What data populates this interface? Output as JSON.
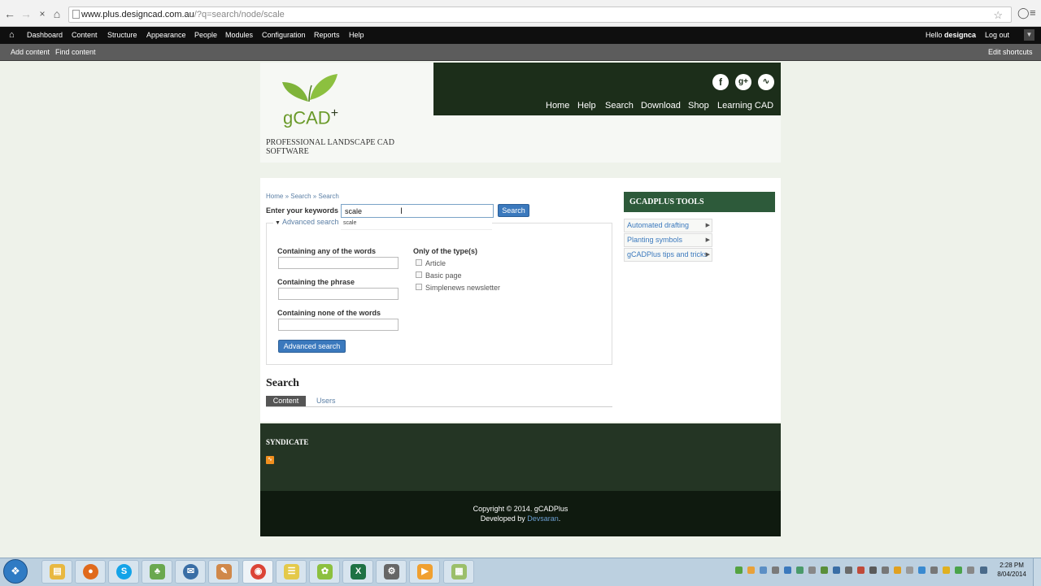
{
  "browser": {
    "url_main": "www.plus.designcad.com.au",
    "url_rest": "/?q=search/node/scale"
  },
  "toolbar": {
    "items": [
      "Dashboard",
      "Content",
      "Structure",
      "Appearance",
      "People",
      "Modules",
      "Configuration",
      "Reports",
      "Help"
    ],
    "hello_prefix": "Hello ",
    "username": "designca",
    "logout": "Log out"
  },
  "shortcuts": {
    "add_content": "Add content",
    "find_content": "Find content",
    "edit_shortcuts": "Edit shortcuts"
  },
  "header": {
    "logo_text": "gCAD",
    "logo_plus": "+",
    "slogan": "PROFESSIONAL LANDSCAPE CAD SOFTWARE",
    "social": [
      "facebook-icon",
      "google-plus-icon",
      "rss-icon"
    ],
    "menu": [
      "Home",
      "Help",
      "Search",
      "Download",
      "Shop",
      "Learning CAD"
    ]
  },
  "search_form": {
    "breadcrumb": "Home » Search » Search",
    "keywords_label": "Enter your keywords",
    "keywords_value": "scale",
    "autocomplete": "scale",
    "search_button": "Search",
    "advanced_legend": "Advanced search",
    "any_label": "Containing any of the words",
    "phrase_label": "Containing the phrase",
    "none_label": "Containing none of the words",
    "types_label": "Only of the type(s)",
    "types": [
      "Article",
      "Basic page",
      "Simplenews newsletter"
    ],
    "advanced_button": "Advanced search"
  },
  "results": {
    "title": "Search",
    "tabs": [
      "Content",
      "Users"
    ]
  },
  "sidebar": {
    "title": "GCADPLUS TOOLS",
    "items": [
      "Automated drafting",
      "Planting symbols",
      "gCADPlus tips and tricks"
    ]
  },
  "footer": {
    "syndicate": "SYNDICATE",
    "copyright": "Copyright © 2014. gCADPlus",
    "developed_by": "Developed by ",
    "developer": "Devsaran",
    "period": "."
  },
  "taskbar": {
    "time": "2:28 PM",
    "date": "8/04/2014"
  },
  "colors": {
    "header_dark": "#1c2e1a",
    "block_green": "#2d5a3a",
    "button_blue": "#3b79bd",
    "link_blue": "#5b7fa5"
  }
}
